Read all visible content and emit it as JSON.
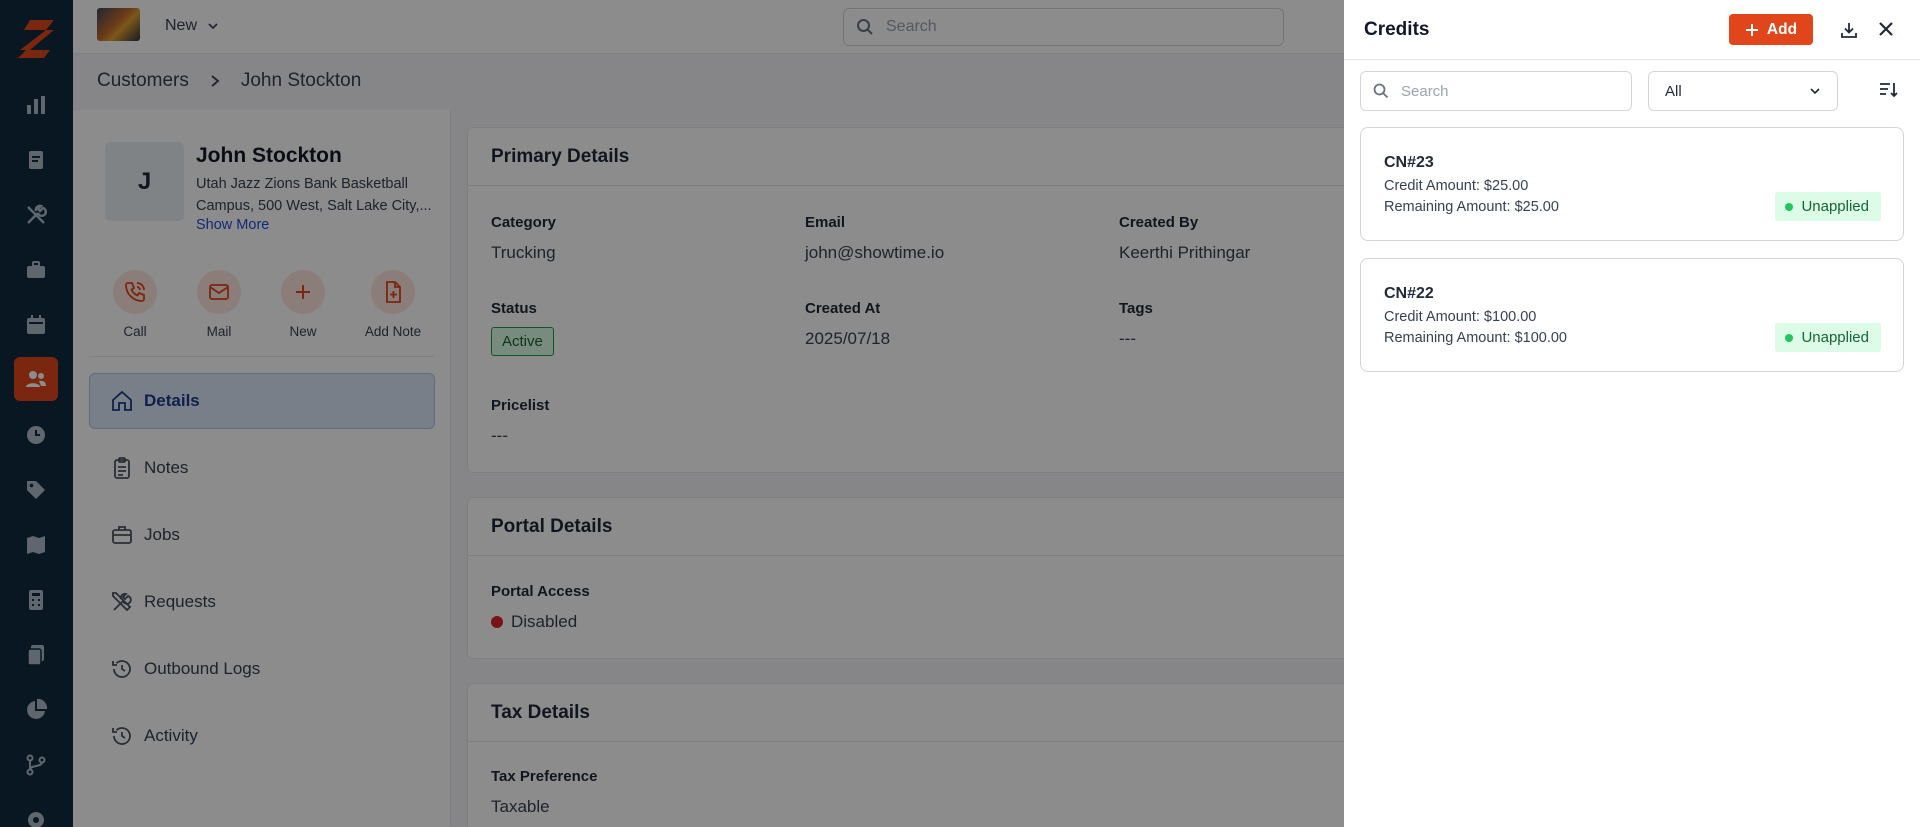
{
  "topbar": {
    "new_label": "New",
    "search_placeholder": "Search"
  },
  "breadcrumb": {
    "root": "Customers",
    "current": "John Stockton"
  },
  "customer": {
    "initial": "J",
    "name": "John Stockton",
    "address": "Utah Jazz Zions Bank Basketball Campus, 500 West, Salt Lake City,...",
    "show_more": "Show More"
  },
  "actions": [
    {
      "label": "Call",
      "icon": "phone-icon"
    },
    {
      "label": "Mail",
      "icon": "mail-icon"
    },
    {
      "label": "New",
      "icon": "plus-icon"
    },
    {
      "label": "Add Note",
      "icon": "add-note-icon"
    }
  ],
  "nav": [
    {
      "label": "Details",
      "icon": "home-icon",
      "active": true
    },
    {
      "label": "Notes",
      "icon": "clipboard-icon"
    },
    {
      "label": "Jobs",
      "icon": "briefcase-icon"
    },
    {
      "label": "Requests",
      "icon": "tools-icon"
    },
    {
      "label": "Outbound Logs",
      "icon": "history-icon"
    },
    {
      "label": "Activity",
      "icon": "history-icon"
    }
  ],
  "primary": {
    "title": "Primary Details",
    "category_label": "Category",
    "category": "Trucking",
    "email_label": "Email",
    "email": "john@showtime.io",
    "created_by_label": "Created By",
    "created_by": "Keerthi Prithingar",
    "status_label": "Status",
    "status": "Active",
    "created_at_label": "Created At",
    "created_at": "2025/07/18",
    "tags_label": "Tags",
    "tags": "---",
    "pricelist_label": "Pricelist",
    "pricelist": "---"
  },
  "portal": {
    "title": "Portal Details",
    "access_label": "Portal Access",
    "access": "Disabled"
  },
  "tax": {
    "title": "Tax Details",
    "pref_label": "Tax Preference",
    "pref": "Taxable"
  },
  "drawer": {
    "title": "Credits",
    "add_label": "Add",
    "search_placeholder": "Search",
    "filter_value": "All",
    "credits": [
      {
        "number": "CN#23",
        "credit": "Credit Amount: $25.00",
        "remaining": "Remaining Amount: $25.00",
        "status": "Unapplied"
      },
      {
        "number": "CN#22",
        "credit": "Credit Amount: $100.00",
        "remaining": "Remaining Amount: $100.00",
        "status": "Unapplied"
      }
    ]
  },
  "colors": {
    "accent": "#e0451b",
    "rail": "#0f2a3d",
    "success": "#22c55e"
  }
}
